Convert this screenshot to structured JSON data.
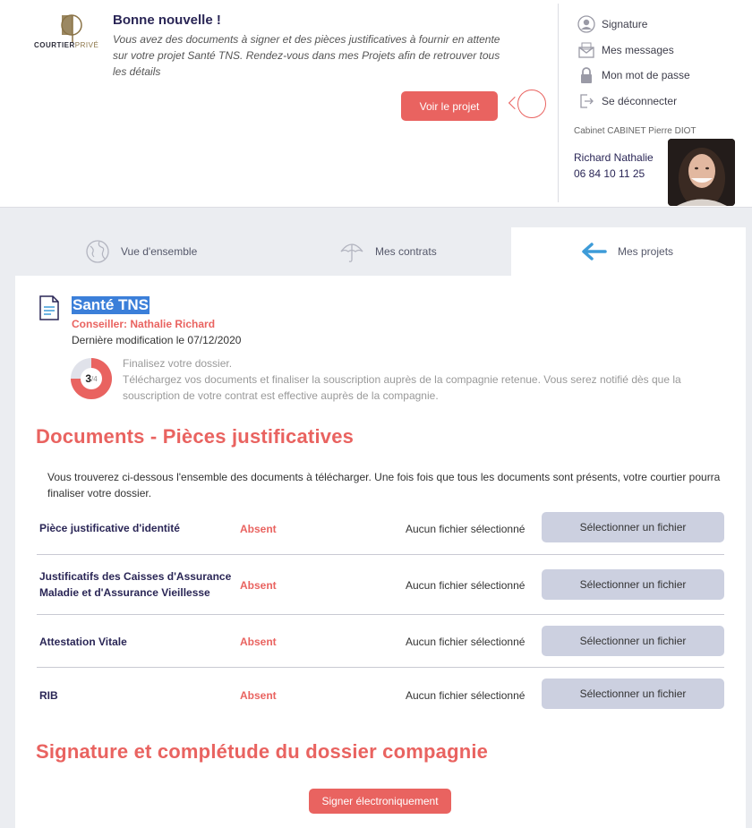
{
  "logo": {
    "brand_main": "COURTIER",
    "brand_accent": "PRIVÉ"
  },
  "notification": {
    "title": "Bonne nouvelle !",
    "body": "Vous avez des documents à signer et des pièces justificatives à fournir en attente sur votre projet Santé TNS. Rendez-vous dans mes Projets afin de retrouver tous les détails",
    "button": "Voir le projet"
  },
  "account_menu": {
    "items": [
      {
        "label": "Signature",
        "icon": "user-circle-icon"
      },
      {
        "label": "Mes messages",
        "icon": "envelope-icon"
      },
      {
        "label": "Mon mot de passe",
        "icon": "lock-icon"
      },
      {
        "label": "Se déconnecter",
        "icon": "logout-icon"
      }
    ]
  },
  "contact": {
    "cabinet": "Cabinet CABINET Pierre DIOT",
    "name": "Richard Nathalie",
    "phone": "06 84 10 11 25"
  },
  "tabs": [
    {
      "label": "Vue d'ensemble",
      "icon": "globe-icon",
      "active": false
    },
    {
      "label": "Mes contrats",
      "icon": "umbrella-icon",
      "active": false
    },
    {
      "label": "Mes projets",
      "icon": "arrow-left-icon",
      "active": true
    }
  ],
  "project": {
    "title": "Santé TNS",
    "conseiller": "Conseiller: Nathalie Richard",
    "last_modified": "Dernière modification le 07/12/2020",
    "progress_current": "3",
    "progress_total": "/4",
    "progress_fraction": 0.75,
    "step_title": "Finalisez votre dossier.",
    "step_body": "Téléchargez vos documents et finaliser la souscription auprès de la compagnie retenue. Vous serez notifié dès que la souscription de votre contrat est effective auprès de la compagnie."
  },
  "documents": {
    "title": "Documents - Pièces justificatives",
    "intro": "Vous trouverez ci-dessous l'ensemble des documents à télécharger. Une fois fois que tous les documents sont présents, votre courtier pourra finaliser votre dossier.",
    "rows": [
      {
        "name": "Pièce justificative d'identité",
        "status": "Absent",
        "file": "Aucun fichier sélectionné",
        "button": "Sélectionner un fichier"
      },
      {
        "name": "Justificatifs des Caisses d'Assurance Maladie et d'Assurance Vieillesse",
        "status": "Absent",
        "file": "Aucun fichier sélectionné",
        "button": "Sélectionner un fichier"
      },
      {
        "name": "Attestation Vitale",
        "status": "Absent",
        "file": "Aucun fichier sélectionné",
        "button": "Sélectionner un fichier"
      },
      {
        "name": "RIB",
        "status": "Absent",
        "file": "Aucun fichier sélectionné",
        "button": "Sélectionner un fichier"
      }
    ]
  },
  "signature": {
    "title": "Signature et complétude du dossier compagnie",
    "button": "Signer électroniquement"
  },
  "colors": {
    "accent": "#e96360",
    "navy": "#2a2656",
    "file_button": "#ccd0e0",
    "tab_arrow": "#3d9bd8"
  }
}
